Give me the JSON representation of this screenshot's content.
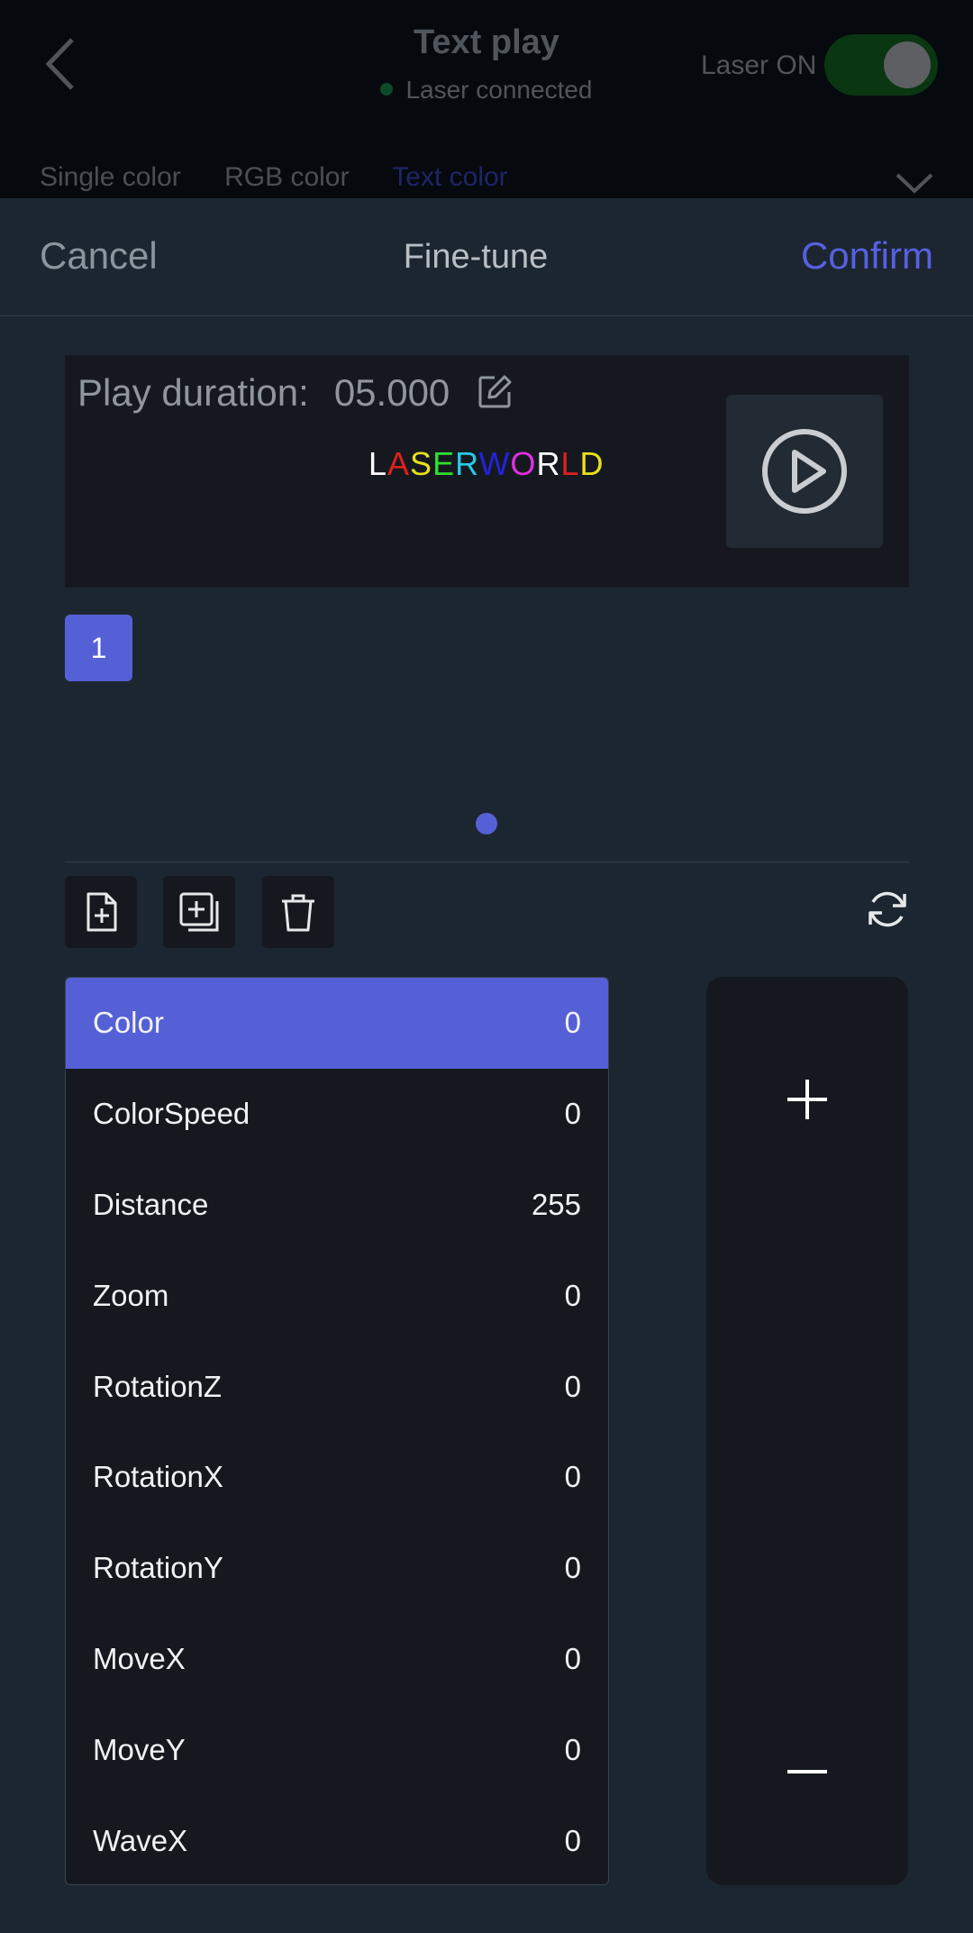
{
  "background": {
    "title": "Text play",
    "status": "Laser connected",
    "laser_label": "Laser ON",
    "laser_on": true,
    "tabs": [
      "Single color",
      "RGB color",
      "Text color"
    ],
    "active_tab": "Text color"
  },
  "sheet": {
    "cancel": "Cancel",
    "title": "Fine-tune",
    "confirm": "Confirm"
  },
  "preview": {
    "duration_label": "Play duration:",
    "duration_value": "05.000",
    "text_letters": [
      {
        "ch": "L",
        "color": "#ffffff"
      },
      {
        "ch": "A",
        "color": "#e01f1f"
      },
      {
        "ch": "S",
        "color": "#e8e01c"
      },
      {
        "ch": "E",
        "color": "#2fe02f"
      },
      {
        "ch": "R",
        "color": "#27c9e6"
      },
      {
        "ch": "W",
        "color": "#2222e0"
      },
      {
        "ch": "O",
        "color": "#e02fe0"
      },
      {
        "ch": "R",
        "color": "#ffffff"
      },
      {
        "ch": "L",
        "color": "#e01f1f"
      },
      {
        "ch": "D",
        "color": "#e8e01c"
      }
    ]
  },
  "pages": [
    "1"
  ],
  "params": [
    {
      "name": "Color",
      "value": "0",
      "selected": true
    },
    {
      "name": "ColorSpeed",
      "value": "0"
    },
    {
      "name": "Distance",
      "value": "255"
    },
    {
      "name": "Zoom",
      "value": "0"
    },
    {
      "name": "RotationZ",
      "value": "0"
    },
    {
      "name": "RotationX",
      "value": "0"
    },
    {
      "name": "RotationY",
      "value": "0"
    },
    {
      "name": "MoveX",
      "value": "0"
    },
    {
      "name": "MoveY",
      "value": "0"
    },
    {
      "name": "WaveX",
      "value": "0"
    }
  ],
  "icons": {
    "back": "chevron-left-icon",
    "chevron": "chevron-down-icon",
    "edit": "edit-icon",
    "play": "play-icon",
    "add_page": "file-add-icon",
    "copy_page": "copy-add-icon",
    "delete": "trash-icon",
    "refresh": "refresh-icon",
    "increase": "plus-icon",
    "decrease": "minus-icon"
  },
  "colors": {
    "accent": "#5560d6",
    "confirm": "#5760e0"
  }
}
